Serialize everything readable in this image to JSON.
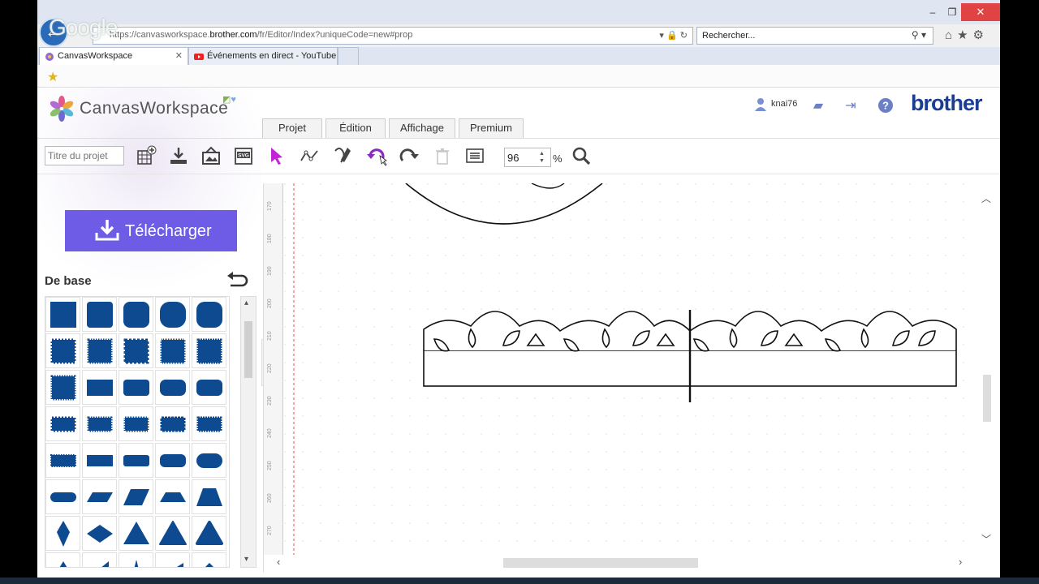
{
  "browser": {
    "url_prefix": "https://canvasworkspace.",
    "url_domain": "brother.com",
    "url_suffix": "/fr/Editor/Index?uniqueCode=new#prop",
    "search_placeholder": "Rechercher...",
    "google_logo": "Google",
    "tabs": [
      {
        "label": "CanvasWorkspace",
        "icon": "canvasworkspace-favicon"
      },
      {
        "label": "Événements en direct - YouTube",
        "icon": "youtube-icon"
      }
    ]
  },
  "app": {
    "logo_text": "CanvasWorkspace",
    "brand": "brother",
    "user": "knai76",
    "menu_tabs": [
      "Projet",
      "Édition",
      "Affichage",
      "Premium"
    ],
    "project_title_placeholder": "Titre du projet",
    "zoom_value": "96",
    "zoom_unit": "%",
    "download_label": "Télécharger",
    "panel_title": "De base",
    "ruler_labels": [
      "170",
      "180",
      "190",
      "200",
      "210",
      "220",
      "230",
      "240",
      "250",
      "260",
      "270",
      "280"
    ],
    "accent_color": "#6e5ce6",
    "shape_color": "#0e4a8f"
  }
}
